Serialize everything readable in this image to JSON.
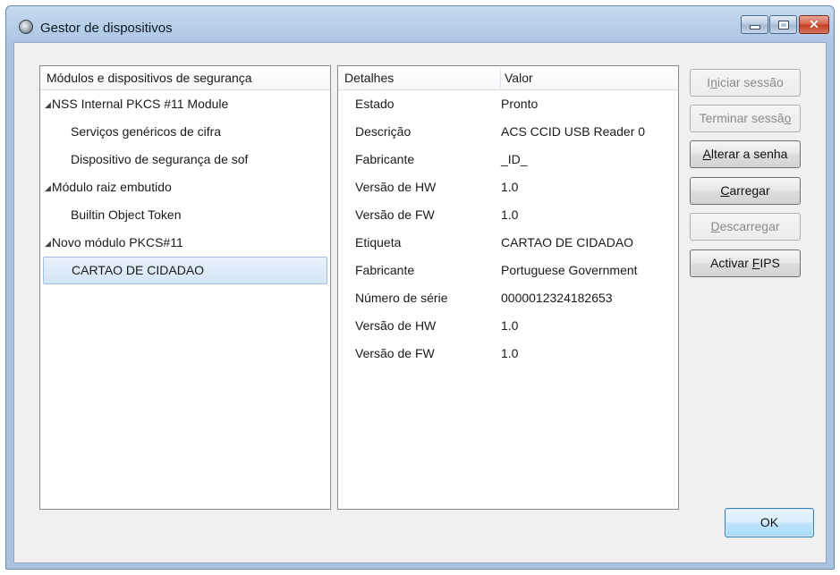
{
  "window": {
    "title": "Gestor de dispositivos",
    "min_glyph": "",
    "close_glyph": "✕"
  },
  "tree": {
    "header": "Módulos e dispositivos de segurança",
    "expand_glyph": "◢",
    "items": [
      {
        "label": "NSS Internal PKCS #11 Module",
        "level": 0
      },
      {
        "label": "Serviços genéricos de cifra",
        "level": 1
      },
      {
        "label": "Dispositivo de segurança de sof",
        "level": 1
      },
      {
        "label": "Módulo raiz embutido",
        "level": 0
      },
      {
        "label": "Builtin Object Token",
        "level": 1
      },
      {
        "label": "Novo módulo PKCS#11",
        "level": 0
      },
      {
        "label": "CARTAO DE CIDADAO",
        "level": 1,
        "selected": true
      }
    ]
  },
  "details": {
    "header_key": "Detalhes",
    "header_value": "Valor",
    "rows": [
      {
        "key": "Estado",
        "value": "Pronto"
      },
      {
        "key": "Descrição",
        "value": "ACS CCID USB Reader 0"
      },
      {
        "key": "Fabricante",
        "value": "_ID_"
      },
      {
        "key": "Versão de HW",
        "value": "1.0"
      },
      {
        "key": "Versão de FW",
        "value": "1.0"
      },
      {
        "key": "Etiqueta",
        "value": "CARTAO DE CIDADAO"
      },
      {
        "key": "Fabricante",
        "value": "Portuguese Government"
      },
      {
        "key": "Número de série",
        "value": "0000012324182653"
      },
      {
        "key": "Versão de HW",
        "value": "1.0"
      },
      {
        "key": "Versão de FW",
        "value": "1.0"
      }
    ]
  },
  "buttons": {
    "login": {
      "pre": "I",
      "u": "n",
      "post": "iciar sessão",
      "enabled": false
    },
    "logout": {
      "pre": "Terminar sessã",
      "u": "o",
      "post": "",
      "enabled": false
    },
    "change_password": {
      "pre": "",
      "u": "A",
      "post": "lterar a senha",
      "enabled": true
    },
    "load": {
      "pre": "",
      "u": "C",
      "post": "arregar",
      "enabled": true
    },
    "unload": {
      "pre": "",
      "u": "D",
      "post": "escarregar",
      "enabled": false
    },
    "fips": {
      "pre": "Activar ",
      "u": "F",
      "post": "IPS",
      "enabled": true
    },
    "ok": {
      "label": "OK"
    }
  }
}
